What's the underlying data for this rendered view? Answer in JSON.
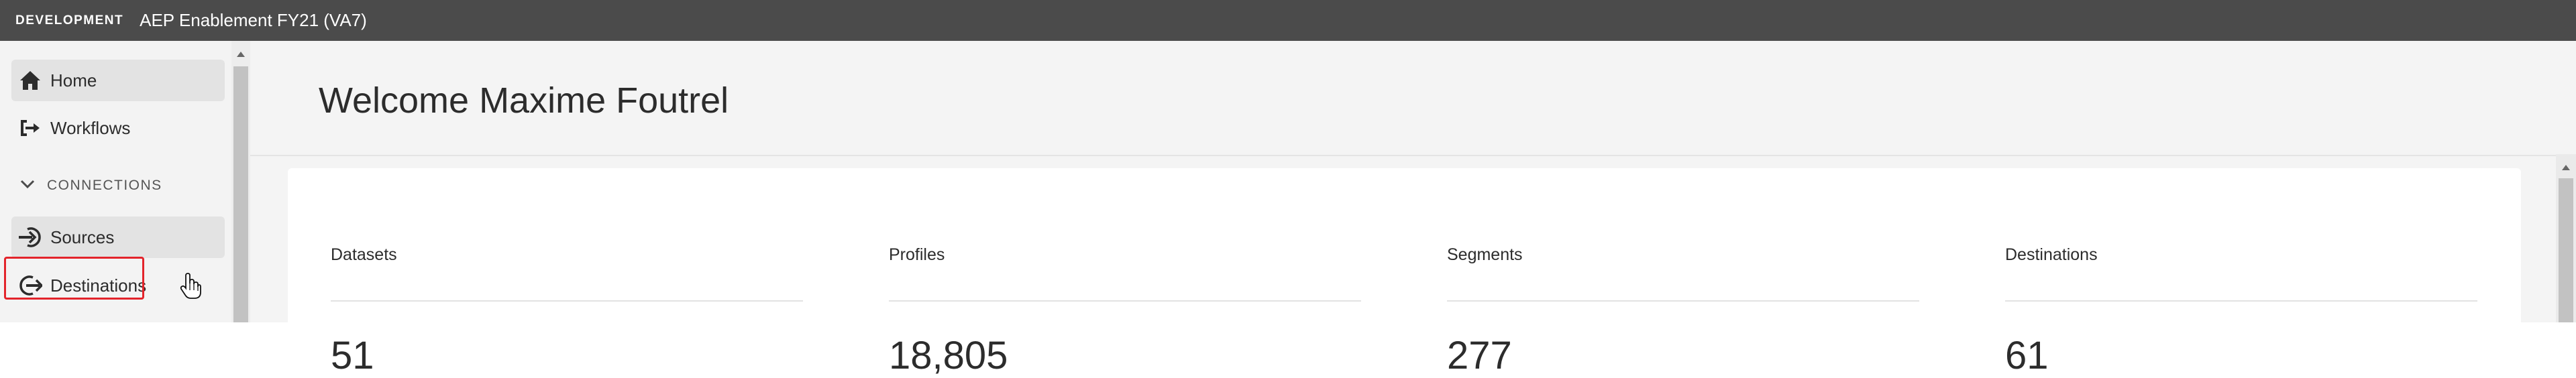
{
  "topbar": {
    "environment": "DEVELOPMENT",
    "org_name": "AEP Enablement FY21 (VA7)"
  },
  "sidebar": {
    "items": [
      {
        "label": "Home",
        "icon": "home-icon",
        "active": true
      },
      {
        "label": "Workflows",
        "icon": "workflow-icon",
        "active": false
      }
    ],
    "section": {
      "label": "CONNECTIONS",
      "icon": "chevron-down-icon"
    },
    "connections": [
      {
        "label": "Sources",
        "icon": "source-login-icon",
        "active": true,
        "focused": true
      },
      {
        "label": "Destinations",
        "icon": "destination-logout-icon",
        "active": false
      }
    ]
  },
  "main": {
    "welcome": "Welcome Maxime Foutrel",
    "metrics": [
      {
        "label": "Datasets",
        "value": "51"
      },
      {
        "label": "Profiles",
        "value": "18,805"
      },
      {
        "label": "Segments",
        "value": "277"
      },
      {
        "label": "Destinations",
        "value": "61"
      }
    ]
  },
  "colors": {
    "topbar_bg": "#4b4b4b",
    "focus_outline": "#e3242b",
    "sidebar_bg": "#f3f3f3",
    "main_bg": "#f4f4f4"
  }
}
